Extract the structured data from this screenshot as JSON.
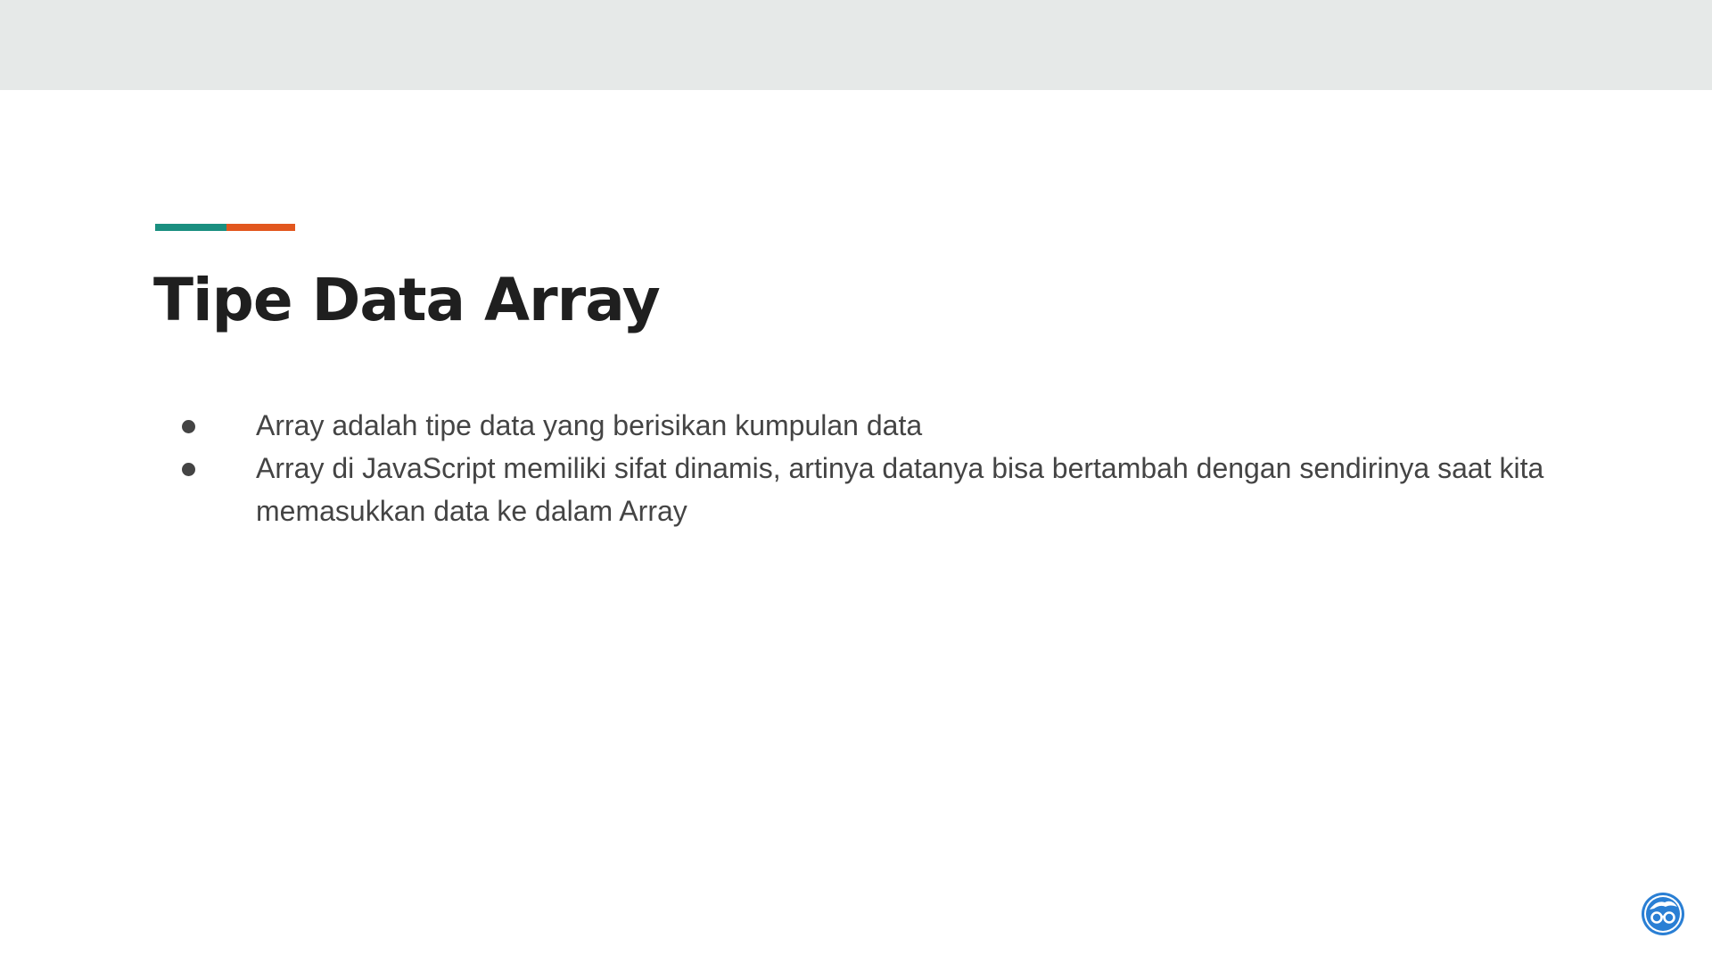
{
  "slide": {
    "title": "Tipe Data Array",
    "bullets": [
      "Array adalah tipe data yang berisikan kumpulan data",
      "Array di JavaScript memiliki sifat dinamis, artinya datanya bisa bertambah dengan sendirinya saat kita memasukkan data ke dalam Array"
    ],
    "logo_icon": "glasses-avatar-icon"
  },
  "colors": {
    "top_band": "#e6e9e8",
    "accent_teal": "#1a8f80",
    "accent_orange": "#e2571e",
    "title_text": "#1f1f1f",
    "body_text": "#444444",
    "logo_blue": "#2a7fd4"
  }
}
